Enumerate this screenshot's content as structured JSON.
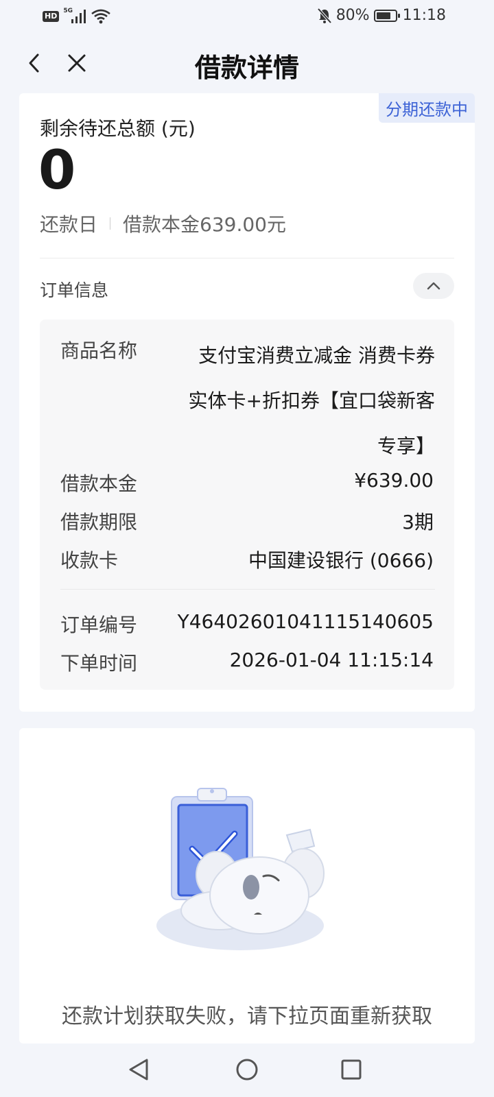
{
  "status_bar": {
    "hd_badge": "HD",
    "network_type": "5G",
    "battery_percent": "80%",
    "battery_level": 0.8,
    "time": "11:18",
    "icons": [
      "signal-icon",
      "wifi-icon",
      "mute-bell-icon",
      "battery-icon"
    ]
  },
  "header": {
    "title": "借款详情",
    "back_icon": "chevron-left-icon",
    "close_icon": "close-icon"
  },
  "loan": {
    "status_tag": "分期还款中",
    "remaining_label": "剩余待还总额 (元)",
    "remaining_amount": "0",
    "repay_day_label": "还款日",
    "principal_summary": "借款本金639.00元"
  },
  "order": {
    "section_title": "订单信息",
    "collapse_icon": "chevron-up-icon",
    "product_label": "商品名称",
    "product_value": "支付宝消费立减金 消费卡券 实体卡+折扣券【宜口袋新客专享】",
    "principal_label": "借款本金",
    "principal_value": "¥639.00",
    "term_label": "借款期限",
    "term_value": "3期",
    "card_label": "收款卡",
    "card_value": "中国建设银行 (0666)",
    "order_no_label": "订单编号",
    "order_no_value": "Y46402601041115140605",
    "order_time_label": "下单时间",
    "order_time_value": "2026-01-04 11:15:14"
  },
  "plan": {
    "illustration": "koala-clipboard-illustration",
    "fail_message": "还款计划获取失败，请下拉页面重新获取"
  },
  "nav": {
    "back_icon": "triangle-back-icon",
    "home_icon": "circle-home-icon",
    "recents_icon": "square-recents-icon"
  },
  "colors": {
    "accent": "#3d63d6",
    "tag_bg": "#e6ecfa",
    "page_bg": "#f3f5fa"
  }
}
